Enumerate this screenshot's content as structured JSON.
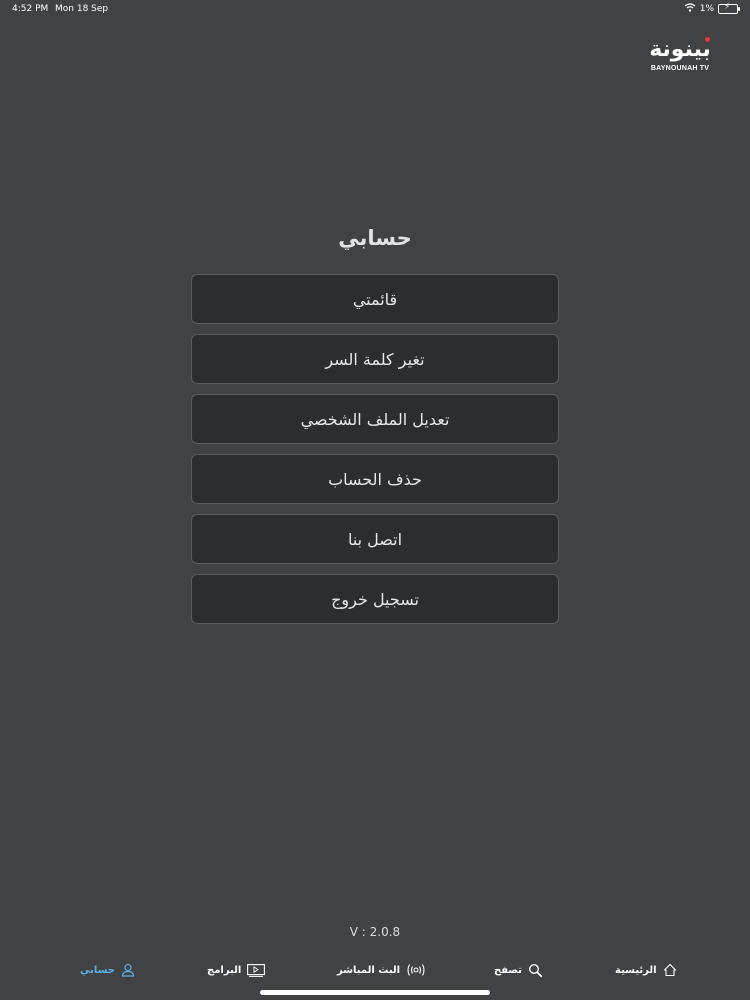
{
  "status_bar": {
    "time": "4:52 PM",
    "date": "Mon 18 Sep",
    "battery": "1%",
    "icons": [
      "wifi-icon",
      "battery-icon"
    ]
  },
  "logo": {
    "arabic": "بينونة",
    "english": "BAYNOUNAH TV",
    "accent_color": "#e03a3a"
  },
  "page": {
    "title": "حسابي"
  },
  "menu": {
    "items": [
      {
        "label": "قائمتي"
      },
      {
        "label": "تغير كلمة السر"
      },
      {
        "label": "تعديل الملف الشخصي"
      },
      {
        "label": "حذف الحساب"
      },
      {
        "label": "اتصل بنا"
      },
      {
        "label": "تسجيل خروج"
      }
    ]
  },
  "version": "V : 2.0.8",
  "bottom_nav": {
    "active_color": "#5ab0ea",
    "items": [
      {
        "label": "حسابي",
        "icon": "user-icon",
        "active": true
      },
      {
        "label": "البرامج",
        "icon": "tv-icon",
        "active": false
      },
      {
        "label": "البث المباشر",
        "icon": "broadcast-icon",
        "active": false
      },
      {
        "label": "تصفح",
        "icon": "search-icon",
        "active": false
      },
      {
        "label": "الرئيسية",
        "icon": "home-icon",
        "active": false
      }
    ]
  }
}
